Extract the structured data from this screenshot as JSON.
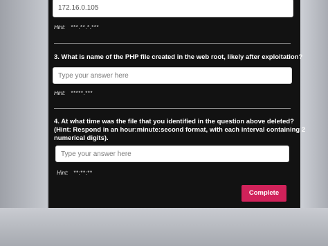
{
  "answer_field_q2": {
    "value": "172.16.0.105"
  },
  "hint_q2": {
    "label": "Hint:",
    "mask": "***.**.*.***"
  },
  "question3": {
    "text": "3. What is name of the PHP file created in the web root, likely after exploitation?",
    "placeholder": "Type your answer here",
    "hint_label": "Hint:",
    "hint_mask": "*****.***"
  },
  "question4": {
    "line1": "4. At what time was the file that you identified in the question above deleted?",
    "line2": "(Hint: Respond in an hour:minute:second format, with each interval containing 2",
    "line3": "numerical digits).",
    "placeholder": "Type your answer here",
    "hint_label": "Hint:",
    "hint_mask": "**:**:**"
  },
  "complete_button": {
    "label": "Complete"
  },
  "colors": {
    "accent": "#d1225a",
    "panel": "#121212"
  }
}
